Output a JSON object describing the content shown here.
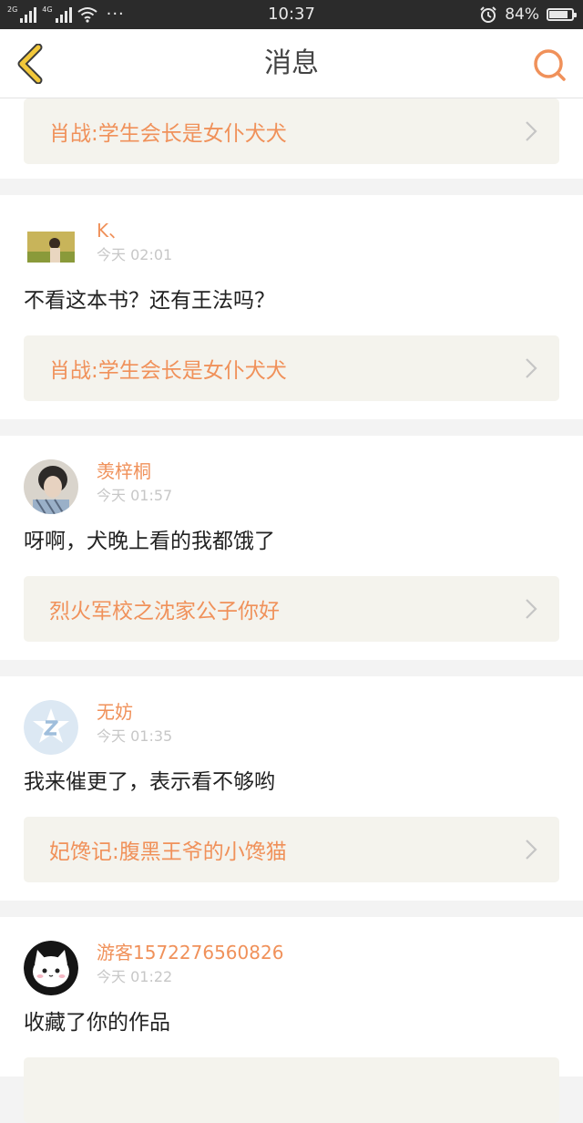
{
  "status_bar": {
    "network_1": "2G",
    "network_2": "4G",
    "more": "···",
    "time": "10:37",
    "battery": "84%",
    "battery_level": 0.84
  },
  "header": {
    "title": "消息"
  },
  "feed": {
    "top_card_link": "肖战:学生会长是女仆犬犬",
    "items": [
      {
        "user": "K、",
        "time": "今天 02:01",
        "message": "不看这本书？还有王法吗？",
        "link": "肖战:学生会长是女仆犬犬"
      },
      {
        "user": "羡梓桐",
        "time": "今天 01:57",
        "message": "呀啊，犬晚上看的我都饿了",
        "link": "烈火军校之沈家公子你好"
      },
      {
        "user": "无妨",
        "time": "今天 01:35",
        "message": "我来催更了，表示看不够哟",
        "link": "妃馋记:腹黑王爷的小馋猫"
      },
      {
        "user": "游客1572276560826",
        "time": "今天 01:22",
        "message": "收藏了你的作品"
      }
    ]
  },
  "colors": {
    "accent": "#f0915a",
    "status_bar_bg": "#2b2b2b",
    "back_icon": "#f2c83a",
    "link_bg": "#f4f3ed"
  },
  "icons": {
    "back": "back-chevron-icon",
    "search": "search-icon",
    "chevron": "chevron-right-icon",
    "wifi": "wifi-icon",
    "alarm": "alarm-icon",
    "battery": "battery-icon"
  }
}
